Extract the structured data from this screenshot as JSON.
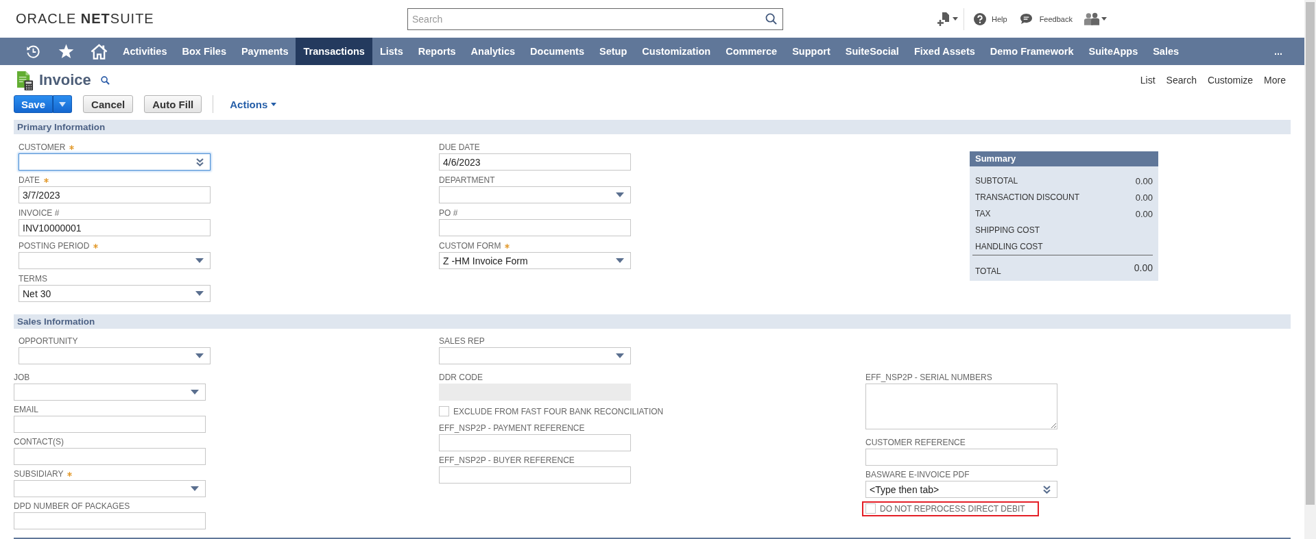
{
  "header": {
    "logo": "ORACLE **NET**SUITE",
    "search": {
      "placeholder": "Search"
    },
    "help": {
      "label": "Help"
    },
    "feedback": {
      "label": "Feedback"
    }
  },
  "nav": {
    "items": [
      {
        "label": "Activities",
        "selected": false
      },
      {
        "label": "Box Files",
        "selected": false
      },
      {
        "label": "Payments",
        "selected": false
      },
      {
        "label": "Transactions",
        "selected": true
      },
      {
        "label": "Lists",
        "selected": false
      },
      {
        "label": "Reports",
        "selected": false
      },
      {
        "label": "Analytics",
        "selected": false
      },
      {
        "label": "Documents",
        "selected": false
      },
      {
        "label": "Setup",
        "selected": false
      },
      {
        "label": "Customization",
        "selected": false
      },
      {
        "label": "Commerce",
        "selected": false
      },
      {
        "label": "Support",
        "selected": false
      },
      {
        "label": "SuiteSocial",
        "selected": false
      },
      {
        "label": "Fixed Assets",
        "selected": false
      },
      {
        "label": "Demo Framework",
        "selected": false
      },
      {
        "label": "SuiteApps",
        "selected": false
      },
      {
        "label": "Sales",
        "selected": false
      }
    ],
    "more": "..."
  },
  "page": {
    "title": "Invoice",
    "links": [
      "List",
      "Search",
      "Customize",
      "More"
    ]
  },
  "toolbar": {
    "buttons": [
      {
        "label": "Save",
        "kind": "primary"
      },
      {
        "label": "Cancel",
        "kind": "secondary"
      },
      {
        "label": "Auto Fill",
        "kind": "secondary"
      }
    ],
    "actions": "Actions"
  },
  "primary_information": {
    "title": "Primary Information",
    "columns": [
      [
        {
          "label": "CUSTOMER",
          "kind": "combo",
          "required": true,
          "focused": true,
          "disabled": false
        },
        {
          "label": "DATE",
          "kind": "text",
          "value": "3/7/2023",
          "required": true,
          "focused": false,
          "disabled": false
        },
        {
          "label": "INVOICE #",
          "kind": "text",
          "value": "INV10000001",
          "required": false,
          "focused": false,
          "disabled": false
        },
        {
          "label": "POSTING PERIOD",
          "kind": "select",
          "required": true,
          "focused": false,
          "disabled": false
        },
        {
          "label": "TERMS",
          "kind": "select",
          "value": "Net 30",
          "required": false,
          "focused": false,
          "disabled": false
        }
      ],
      [
        {
          "label": "DUE DATE",
          "kind": "text",
          "value": "4/6/2023",
          "required": false,
          "focused": false,
          "disabled": false
        },
        {
          "label": "DEPARTMENT",
          "kind": "select",
          "required": false,
          "focused": false,
          "disabled": false
        },
        {
          "label": "PO #",
          "kind": "text",
          "required": false,
          "focused": false,
          "disabled": false
        },
        {
          "label": "CUSTOM FORM",
          "kind": "select",
          "value": "Z -HM Invoice Form",
          "required": true,
          "focused": false,
          "disabled": false
        }
      ]
    ],
    "summary": {
      "title": "Summary",
      "rows": [
        {
          "label": "SUBTOTAL",
          "value": "0.00"
        },
        {
          "label": "TRANSACTION DISCOUNT",
          "value": "0.00"
        },
        {
          "label": "TAX",
          "value": "0.00"
        },
        {
          "label": "SHIPPING COST"
        },
        {
          "label": "HANDLING COST"
        }
      ],
      "total": {
        "label": "TOTAL",
        "value": "0.00"
      }
    }
  },
  "sales_information": {
    "title": "Sales Information",
    "columns": [
      [
        {
          "label": "OPPORTUNITY",
          "kind": "select",
          "required": false,
          "focused": false,
          "disabled": false
        },
        {
          "label": "JOB",
          "kind": "select",
          "required": false,
          "focused": false,
          "disabled": false
        },
        {
          "label": "EMAIL",
          "kind": "text",
          "required": false,
          "focused": false,
          "disabled": false
        },
        {
          "label": "CONTACT(S)",
          "kind": "text",
          "required": false,
          "focused": false,
          "disabled": false
        },
        {
          "label": "SUBSIDIARY",
          "kind": "select",
          "required": true,
          "focused": false,
          "disabled": false
        },
        {
          "label": "DPD NUMBER OF PACKAGES",
          "kind": "text",
          "required": false,
          "focused": false,
          "disabled": false
        }
      ],
      [
        {
          "label": "SALES REP",
          "kind": "select",
          "required": false,
          "focused": false,
          "disabled": false
        },
        {
          "label": "DDR CODE",
          "kind": "text",
          "required": false,
          "focused": false,
          "disabled": true
        },
        {
          "label": "EXCLUDE FROM FAST FOUR BANK RECONCILIATION",
          "kind": "checkbox",
          "checked": false,
          "highlighted": false
        },
        {
          "label": "EFF_NSP2P - PAYMENT REFERENCE",
          "kind": "text",
          "required": false,
          "focused": false,
          "disabled": false
        },
        {
          "label": "EFF_NSP2P - BUYER REFERENCE",
          "kind": "text",
          "required": false,
          "focused": false,
          "disabled": false
        }
      ],
      [
        {
          "label": "EFF_NSP2P - SERIAL NUMBERS",
          "kind": "textarea",
          "required": false,
          "focused": false,
          "disabled": false
        },
        {
          "label": "CUSTOMER REFERENCE",
          "kind": "text",
          "required": false,
          "focused": false,
          "disabled": false
        },
        {
          "label": "BASWARE E-INVOICE PDF",
          "kind": "combo",
          "value": "<Type then tab>",
          "required": false,
          "focused": false,
          "disabled": false
        },
        {
          "label": "DO NOT REPROCESS DIRECT DEBIT",
          "kind": "checkbox",
          "checked": false,
          "highlighted": true
        }
      ]
    ]
  }
}
